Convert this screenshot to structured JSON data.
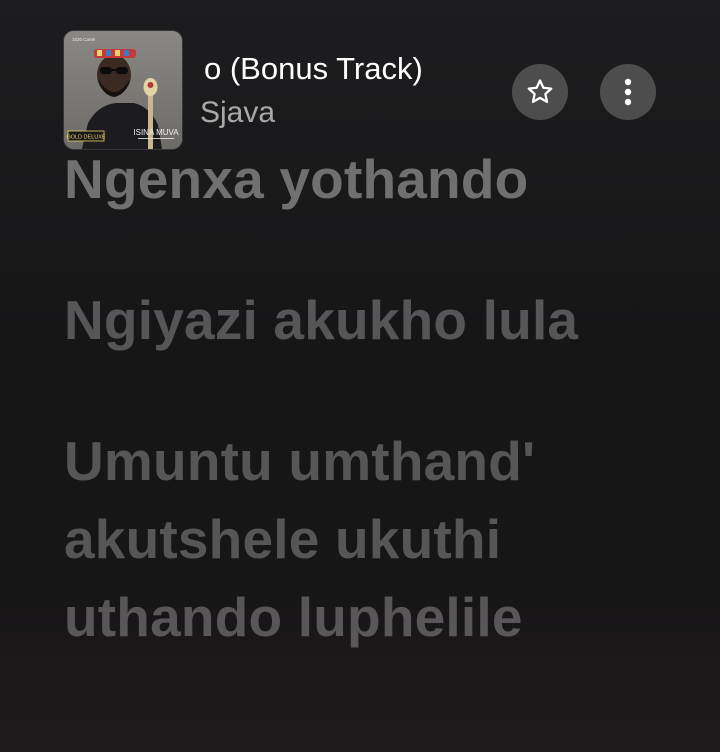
{
  "now_playing": {
    "title": "o (Bonus Track)",
    "artist": "Sjava",
    "artwork": {
      "label_small": "GOLD DELUXE",
      "label_album": "ISINA MUVA",
      "label_top": "1020 Cartel"
    },
    "favorite_icon": "star-outline-icon",
    "more_icon": "vertical-ellipsis-icon"
  },
  "lyrics": [
    {
      "text": "Ngenxa yothando"
    },
    {
      "text": "Ngiyazi akukho lula"
    },
    {
      "text": "Umuntu umthand' akutshele ukuthi uthando luphelile"
    }
  ],
  "colors": {
    "background": "#161617",
    "lyric_inactive": "rgba(255,255,255,0.28)",
    "title": "#ffffff",
    "artist": "rgba(255,255,255,0.62)",
    "button_bg": "rgba(255,255,255,0.22)"
  }
}
